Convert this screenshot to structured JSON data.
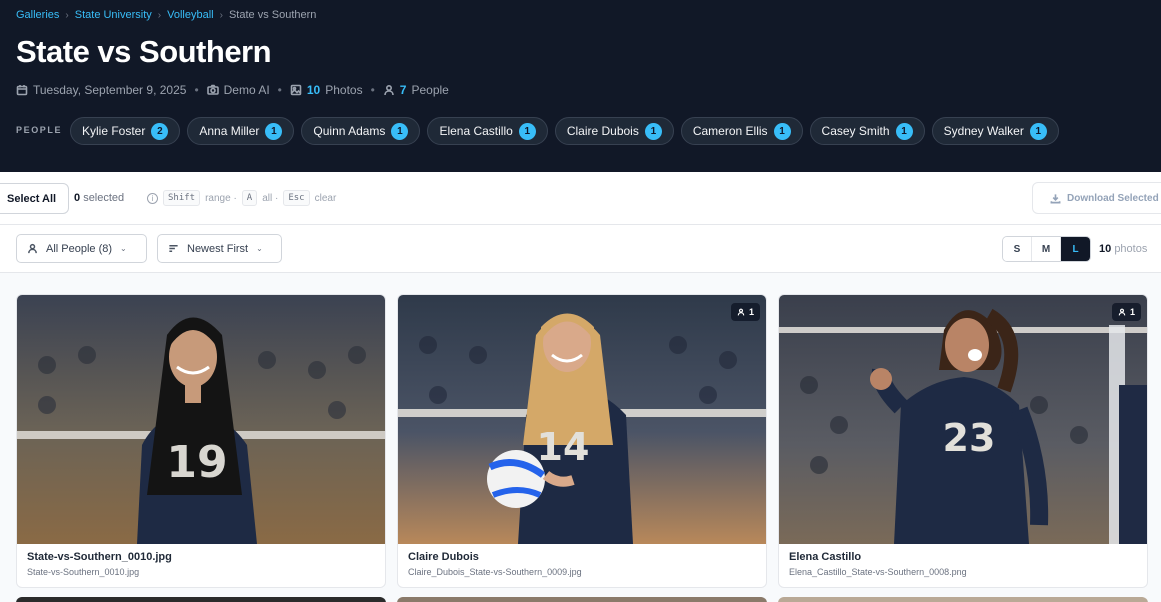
{
  "breadcrumb": [
    {
      "label": "Galleries"
    },
    {
      "label": "State University"
    },
    {
      "label": "Volleyball"
    }
  ],
  "breadcrumb_current": "State vs Southern",
  "title": "State vs Southern",
  "meta": {
    "date": "Tuesday, September 9, 2025",
    "camera": "Demo AI",
    "photos_count": "10",
    "photos_label": "Photos",
    "people_count": "7",
    "people_label": "People"
  },
  "people_label": "PEOPLE",
  "people": [
    {
      "name": "Kylie Foster",
      "count": "2"
    },
    {
      "name": "Anna Miller",
      "count": "1"
    },
    {
      "name": "Quinn Adams",
      "count": "1"
    },
    {
      "name": "Elena Castillo",
      "count": "1"
    },
    {
      "name": "Claire Dubois",
      "count": "1"
    },
    {
      "name": "Cameron Ellis",
      "count": "1"
    },
    {
      "name": "Casey Smith",
      "count": "1"
    },
    {
      "name": "Sydney Walker",
      "count": "1"
    }
  ],
  "selection": {
    "select_all": "Select All",
    "selected_count": "0",
    "selected_label": "selected",
    "hint_shift": "Shift",
    "hint_range": "range ·",
    "hint_a": "A",
    "hint_all": "all ·",
    "hint_esc": "Esc",
    "hint_clear": "clear",
    "download": "Download Selected"
  },
  "filters": {
    "people": "All People (8)",
    "sort": "Newest First",
    "sizes": [
      "S",
      "M",
      "L"
    ],
    "active_size": "L",
    "count": "10",
    "count_label": "photos"
  },
  "photos": [
    {
      "title": "State-vs-Southern_0010.jpg",
      "file": "State-vs-Southern_0010.jpg",
      "jersey": "19",
      "badge": ""
    },
    {
      "title": "Claire Dubois",
      "file": "Claire_Dubois_State-vs-Southern_0009.jpg",
      "jersey": "14",
      "badge": "1"
    },
    {
      "title": "Elena Castillo",
      "file": "Elena_Castillo_State-vs-Southern_0008.png",
      "jersey": "23",
      "badge": "1"
    }
  ],
  "colors": {
    "accent": "#38bdf8",
    "header_bg": "#111827",
    "jersey": "#1e2a44"
  }
}
